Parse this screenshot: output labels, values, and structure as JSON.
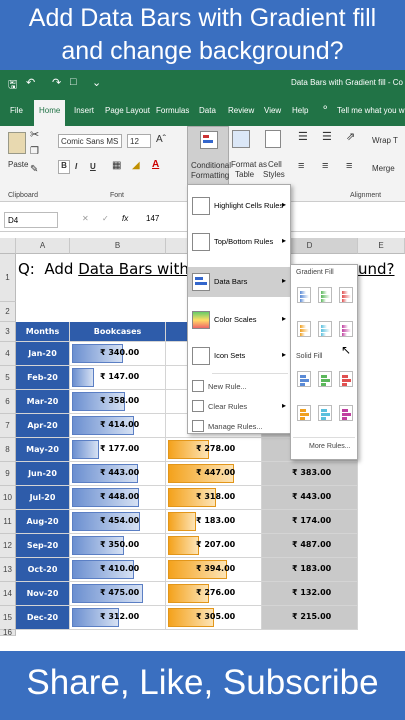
{
  "banner_top": {
    "line1": "Add Data Bars with Gradient fill",
    "line2": "and change background?"
  },
  "banner_bottom": "Share, Like, Subscribe",
  "window_title": "Data Bars with Gradient fill - Co",
  "tabs": [
    "File",
    "Home",
    "Insert",
    "Page Layout",
    "Formulas",
    "Data",
    "Review",
    "View",
    "Help"
  ],
  "tell_me": "Tell me what you want",
  "ribbon": {
    "paste": "Paste",
    "font_name": "Comic Sans MS",
    "font_size": "12",
    "bold": "B",
    "italic": "I",
    "underline": "U",
    "cond_fmt_1": "Conditional",
    "cond_fmt_2": "Formatting",
    "fmt_table_1": "Format as",
    "fmt_table_2": "Table",
    "cell_styles_1": "Cell",
    "cell_styles_2": "Styles",
    "wrap": "Wrap T",
    "merge": "Merge",
    "group_clipboard": "Clipboard",
    "group_font": "Font",
    "group_alignment": "Alignment"
  },
  "formula_bar": {
    "name_box": "D4",
    "fx": "fx",
    "value": "147"
  },
  "columns": [
    "A",
    "B",
    "C",
    "D",
    "E"
  ],
  "question_prefix": "Q:  Add ",
  "question_text": "Data Bars with Grac",
  "question_end": "und?",
  "header_months": "Months",
  "header_bookcases": "Bookcases",
  "months": [
    "Jan-20",
    "Feb-20",
    "Mar-20",
    "Apr-20",
    "May-20",
    "Jun-20",
    "Jul-20",
    "Aug-20",
    "Sep-20",
    "Oct-20",
    "Nov-20",
    "Dec-20"
  ],
  "col_b": [
    "₹ 340.00",
    "₹ 147.00",
    "₹ 358.00",
    "₹ 414.00",
    "₹ 177.00",
    "₹ 443.00",
    "₹ 448.00",
    "₹ 454.00",
    "₹ 350.00",
    "₹ 410.00",
    "₹ 475.00",
    "₹ 312.00"
  ],
  "col_b_fraction": [
    0.55,
    0.24,
    0.58,
    0.67,
    0.29,
    0.72,
    0.73,
    0.74,
    0.57,
    0.67,
    0.77,
    0.51
  ],
  "col_c": [
    "",
    "",
    "",
    "",
    "₹ 278.00",
    "₹ 447.00",
    "₹ 318.00",
    "₹ 183.00",
    "₹ 207.00",
    "₹ 394.00",
    "₹ 276.00",
    "₹ 305.00"
  ],
  "col_c_fraction": [
    0,
    0,
    0,
    0,
    0.45,
    0.72,
    0.52,
    0.3,
    0.34,
    0.64,
    0.45,
    0.5
  ],
  "col_d": [
    "",
    "",
    "",
    "",
    "",
    "₹ 383.00",
    "₹ 443.00",
    "₹ 174.00",
    "₹ 487.00",
    "₹ 183.00",
    "₹ 132.00",
    "₹ 215.00"
  ],
  "row_numbers": [
    "1",
    "2",
    "3",
    "4",
    "5",
    "6",
    "7",
    "8",
    "9",
    "10",
    "11",
    "12",
    "13",
    "14",
    "15",
    "16"
  ],
  "cf_menu": {
    "highlight": "Highlight Cells Rules",
    "topbottom": "Top/Bottom Rules",
    "databars": "Data Bars",
    "colorscales": "Color Scales",
    "iconsets": "Icon Sets",
    "newrule": "New Rule...",
    "clearrules": "Clear Rules",
    "managerules": "Manage Rules..."
  },
  "submenu": {
    "gradient": "Gradient Fill",
    "solid": "Solid Fill",
    "more": "More Rules..."
  },
  "colors": {
    "excel_green": "#217346",
    "banner_blue": "#3a6fc0",
    "month_blue": "#2e5caa",
    "bar_blue": "#6b8fd0",
    "bar_orange": "#f4a21c"
  }
}
